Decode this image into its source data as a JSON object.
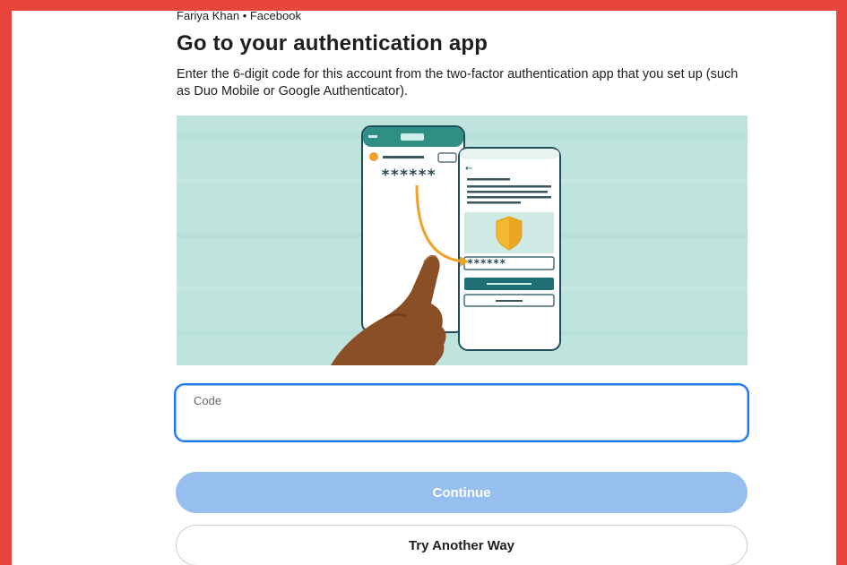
{
  "header": {
    "account_line": "Fariya Khan • Facebook",
    "title": "Go to your authentication app",
    "description": "Enter the 6-digit code for this account from the two-factor authentication app that you set up (such as Duo Mobile or Google Authenticator)."
  },
  "illustration": {
    "code_mask_phone1": "******",
    "code_mask_phone2": "******"
  },
  "form": {
    "code_label": "Code",
    "code_value": ""
  },
  "actions": {
    "continue_label": "Continue",
    "try_another_label": "Try Another Way"
  },
  "colors": {
    "frame": "#e8453c",
    "accent": "#1877f2",
    "continue_disabled": "#96bff0",
    "illustration_bg": "#bfe3dd"
  }
}
